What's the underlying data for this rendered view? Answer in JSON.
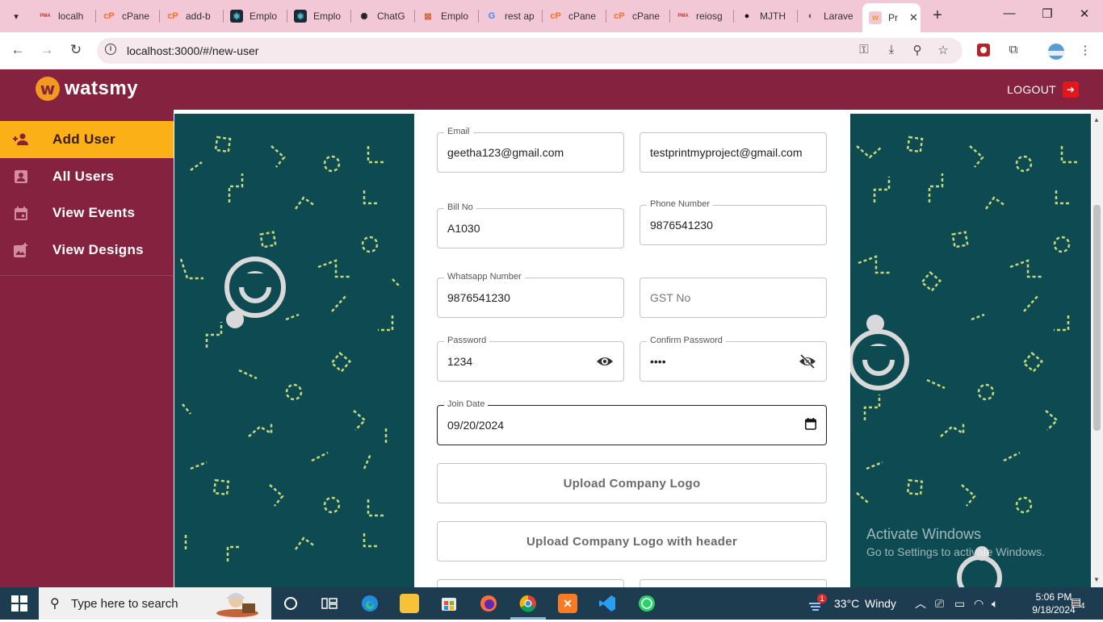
{
  "browser": {
    "tabs": [
      {
        "title": "localh",
        "favicon": "pma"
      },
      {
        "title": "cPane",
        "favicon": "cpanel"
      },
      {
        "title": "add-b",
        "favicon": "cpanel"
      },
      {
        "title": "Emplo",
        "favicon": "react"
      },
      {
        "title": "Emplo",
        "favicon": "react"
      },
      {
        "title": "ChatG",
        "favicon": "chatgpt"
      },
      {
        "title": "Emplo",
        "favicon": "generic"
      },
      {
        "title": "rest ap",
        "favicon": "google"
      },
      {
        "title": "cPane",
        "favicon": "cpanel"
      },
      {
        "title": "cPane",
        "favicon": "cpanel"
      },
      {
        "title": "reiosg",
        "favicon": "pma"
      },
      {
        "title": "MJTH",
        "favicon": "github"
      },
      {
        "title": "Larave",
        "favicon": "globe"
      }
    ],
    "active_tab": {
      "title": "Pr",
      "favicon": "watsmy"
    },
    "url": "localhost:3000/#/new-user"
  },
  "app": {
    "logo_text": "watsmy",
    "logout_label": "LOGOUT",
    "sidebar": [
      {
        "label": "Add User",
        "icon": "add-user-icon",
        "active": true
      },
      {
        "label": "All Users",
        "icon": "users-icon",
        "active": false
      },
      {
        "label": "View Events",
        "icon": "calendar-icon",
        "active": false
      },
      {
        "label": "View Designs",
        "icon": "image-add-icon",
        "active": false
      }
    ]
  },
  "form": {
    "email": {
      "label": "Email",
      "value": "geetha123@gmail.com"
    },
    "secondary_email": {
      "value": "testprintmyproject@gmail.com"
    },
    "bill_no": {
      "label": "Bill No",
      "value": "A1030"
    },
    "phone": {
      "label": "Phone Number",
      "value": "9876541230"
    },
    "whatsapp": {
      "label": "Whatsapp Number",
      "value": "9876541230"
    },
    "gst": {
      "placeholder": "GST No"
    },
    "password": {
      "label": "Password",
      "value": "1234"
    },
    "confirm_password": {
      "label": "Confirm Password",
      "value": "••••"
    },
    "join_date": {
      "label": "Join Date",
      "value": "09/20/2024"
    },
    "upload_logo_label": "Upload Company Logo",
    "upload_logo_header_label": "Upload Company Logo with header"
  },
  "watermark": {
    "line1": "Activate Windows",
    "line2": "Go to Settings to activate Windows."
  },
  "taskbar": {
    "search_placeholder": "Type here to search",
    "weather_temp": "33°C",
    "weather_text": "Windy",
    "notification_badge": "1",
    "time": "5:06 PM",
    "date": "9/18/2024",
    "action_center_count": "4"
  },
  "colors": {
    "brand_maroon": "#84223f",
    "accent_yellow": "#fbb017",
    "pattern_teal": "#0d4a52",
    "pattern_mark": "#c7d87a"
  }
}
